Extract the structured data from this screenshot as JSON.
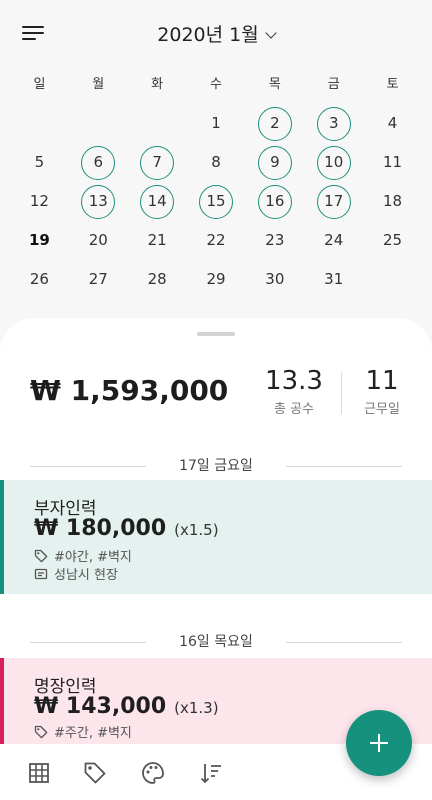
{
  "header": {
    "month_title": "2020년 1월",
    "menu_icon": "hamburger-icon",
    "dropdown_icon": "chevron-down-icon"
  },
  "calendar": {
    "weekdays": [
      "일",
      "월",
      "화",
      "수",
      "목",
      "금",
      "토"
    ],
    "weeks": [
      [
        {
          "d": ""
        },
        {
          "d": ""
        },
        {
          "d": ""
        },
        {
          "d": "1"
        },
        {
          "d": "2",
          "m": true
        },
        {
          "d": "3",
          "m": true
        },
        {
          "d": "4"
        }
      ],
      [
        {
          "d": "5"
        },
        {
          "d": "6",
          "m": true
        },
        {
          "d": "7",
          "m": true
        },
        {
          "d": "8"
        },
        {
          "d": "9",
          "m": true
        },
        {
          "d": "10",
          "m": true
        },
        {
          "d": "11"
        }
      ],
      [
        {
          "d": "12"
        },
        {
          "d": "13",
          "m": true
        },
        {
          "d": "14",
          "m": true
        },
        {
          "d": "15",
          "m": true
        },
        {
          "d": "16",
          "m": true
        },
        {
          "d": "17",
          "m": true
        },
        {
          "d": "18"
        }
      ],
      [
        {
          "d": "19",
          "t": true
        },
        {
          "d": "20"
        },
        {
          "d": "21"
        },
        {
          "d": "22"
        },
        {
          "d": "23"
        },
        {
          "d": "24"
        },
        {
          "d": "25"
        }
      ],
      [
        {
          "d": "26"
        },
        {
          "d": "27"
        },
        {
          "d": "28"
        },
        {
          "d": "29"
        },
        {
          "d": "30"
        },
        {
          "d": "31"
        },
        {
          "d": ""
        }
      ]
    ],
    "marked_color": "#1f8f7d"
  },
  "summary": {
    "total_amount": "₩ 1,593,000",
    "gongsu_value": "13.3",
    "gongsu_label": "총 공수",
    "workdays_value": "11",
    "workdays_label": "근무일"
  },
  "entries": [
    {
      "date_label": "17일 금요일",
      "title": "부자인력",
      "amount": "₩ 180,000",
      "multiplier": "(x1.5)",
      "tags": "#야간, #벽지",
      "memo": "성남시 현장",
      "accent_color": "#15917e",
      "bg_color": "#e4f1ef"
    },
    {
      "date_label": "16일 목요일",
      "title": "명장인력",
      "amount": "₩ 143,000",
      "multiplier": "(x1.3)",
      "tags": "#주간, #벽지",
      "accent_color": "#d8205f",
      "bg_color": "#fce6ec"
    }
  ],
  "bottom_nav": {
    "icons": [
      "calendar-grid-icon",
      "tag-icon",
      "palette-icon",
      "sort-icon"
    ]
  },
  "fab": {
    "icon": "plus-icon",
    "color": "#16917e"
  }
}
